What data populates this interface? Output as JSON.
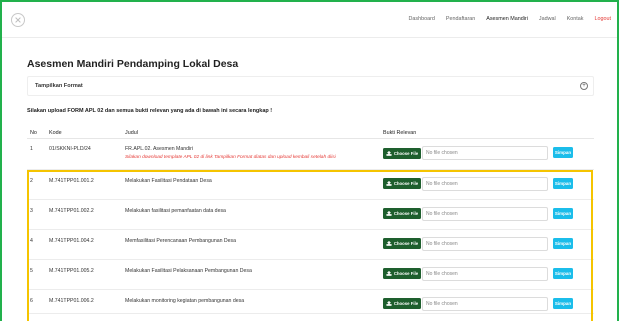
{
  "nav": {
    "items": [
      "Dashboard",
      "Pendaftaran",
      "Asesmen Mandiri",
      "Jadwal",
      "Kontak"
    ],
    "active": "Asesmen Mandiri",
    "logout": "Logout"
  },
  "page": {
    "title": "Asesmen Mandiri Pendamping Lokal Desa",
    "format_label": "Tampilkan Format",
    "instruction": "Silakan upload FORM APL 02 dan semua bukti relevan yang ada di bawah ini secara lengkap !"
  },
  "table": {
    "headers": {
      "no": "No",
      "kode": "Kode",
      "judul": "Judul",
      "bukti": "Bukti Relevan"
    },
    "choose_label": "Choose File",
    "file_placeholder": "No file chosen",
    "save_label": "Simpan",
    "rows": [
      {
        "no": "1",
        "kode": "01/SKKNI-PLD/24",
        "judul": "FR.APL.02. Asesmen Mandiri",
        "note": "Silakan download template APL 02 di link Tampilkan Format diatas dan upload kembali setelah diisi"
      },
      {
        "no": "2",
        "kode": "M.741TPP01.001.2",
        "judul": "Melakukan Fasilitasi Pendataan Desa"
      },
      {
        "no": "3",
        "kode": "M.741TPP01.002.2",
        "judul": "Melakukan fasilitasi pemanfaatan data desa"
      },
      {
        "no": "4",
        "kode": "M.741TPP01.004.2",
        "judul": "Memfasilitasi Perencanaan Pembangunan Desa"
      },
      {
        "no": "5",
        "kode": "M.741TPP01.005.2",
        "judul": "Melakukan Fasilitasi Pelaksanaan Pembangunan Desa"
      },
      {
        "no": "6",
        "kode": "M.741TPP01.006.2",
        "judul": "Melakukan monitoring kegiatan pembangunan desa"
      }
    ]
  },
  "colors": {
    "frame": "#22b14c",
    "highlight": "#f5c400",
    "choose_button": "#1e5f2e",
    "save_button": "#1bbdea",
    "logout": "#e53935"
  }
}
